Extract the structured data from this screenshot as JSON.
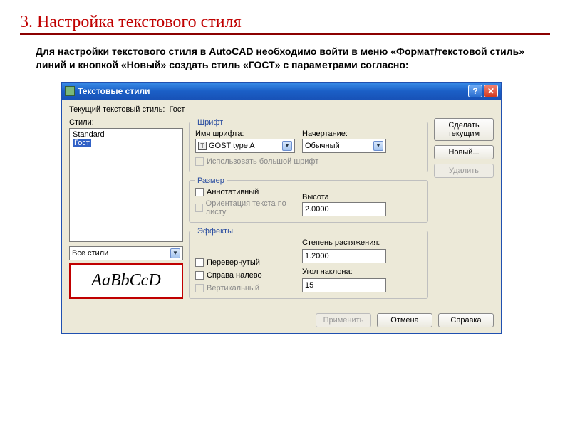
{
  "slide": {
    "title": "3. Настройка текстового стиля",
    "text": "Для настройки текстового стиля в AutoCAD необходимо войти в меню «Формат/текстовой стиль» линий и кнопкой «Новый» создать стиль «ГОСТ» с параметрами согласно:"
  },
  "dialog": {
    "title": "Текстовые стили",
    "current_label_prefix": "Текущий текстовый стиль:",
    "current_style": "Гост",
    "styles_label": "Стили:",
    "styles_list": {
      "item0": "Standard",
      "item1": "Гост"
    },
    "filter_value": "Все стили",
    "preview_text": "AaBbCcD",
    "font": {
      "legend": "Шрифт",
      "name_label": "Имя шрифта:",
      "name_value": "GOST type A",
      "style_label": "Начертание:",
      "style_value": "Обычный",
      "bigfont_label": "Использовать большой шрифт"
    },
    "size": {
      "legend": "Размер",
      "annotative_label": "Аннотативный",
      "orient_label": "Ориентация текста по листу",
      "height_label": "Высота",
      "height_value": "2.0000"
    },
    "effects": {
      "legend": "Эффекты",
      "upside_label": "Перевернутый",
      "backward_label": "Справа налево",
      "vertical_label": "Вертикальный",
      "width_label": "Степень растяжения:",
      "width_value": "1.2000",
      "oblique_label": "Угол наклона:",
      "oblique_value": "15"
    },
    "buttons": {
      "set_current": "Сделать текущим",
      "new": "Новый...",
      "delete": "Удалить",
      "apply": "Применить",
      "cancel": "Отмена",
      "help": "Справка"
    }
  }
}
